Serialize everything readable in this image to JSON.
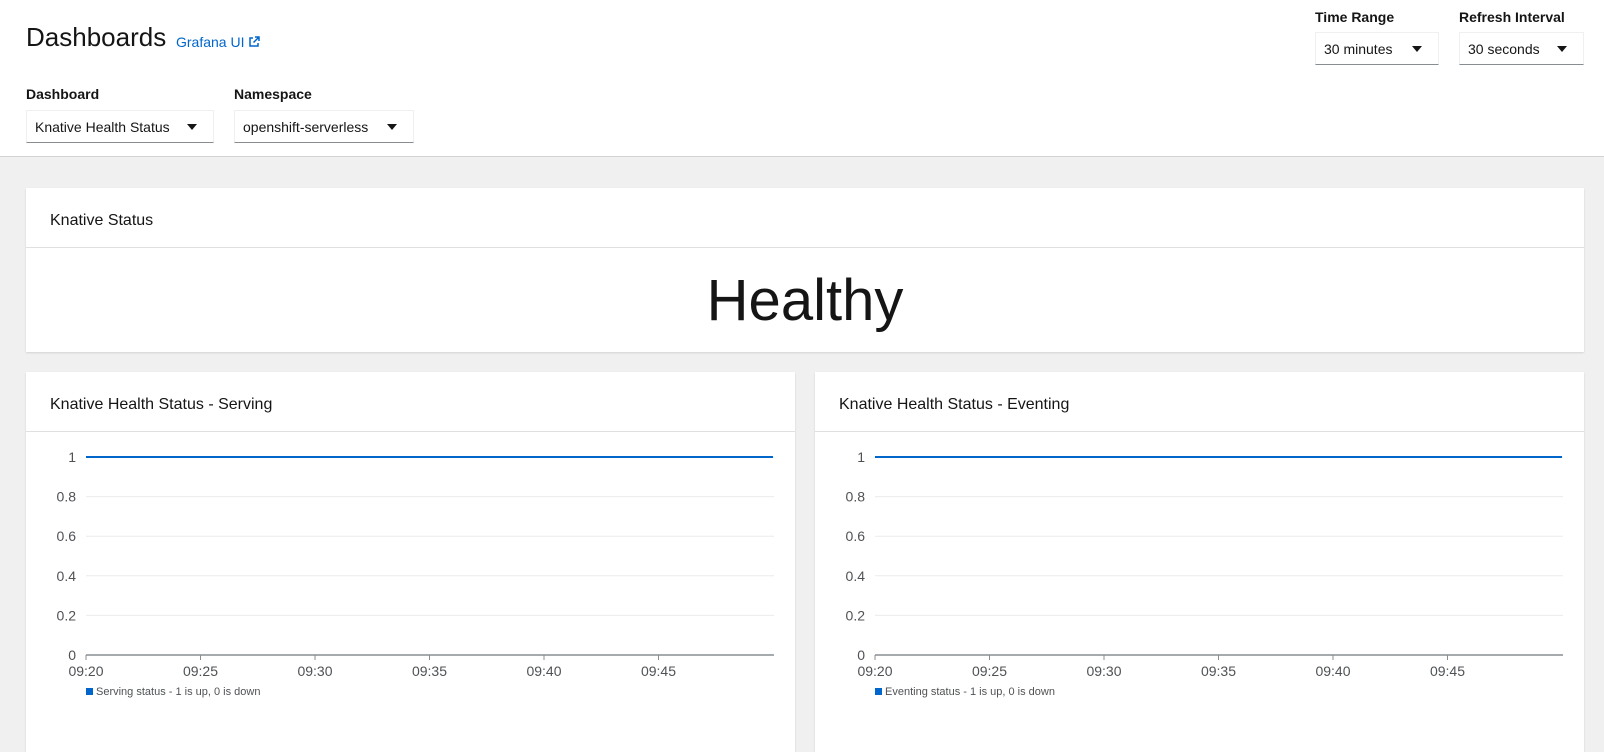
{
  "header": {
    "title": "Dashboards",
    "grafana_link": "Grafana UI",
    "dashboard_label": "Dashboard",
    "dashboard_value": "Knative Health Status",
    "namespace_label": "Namespace",
    "namespace_value": "openshift-serverless",
    "time_range_label": "Time Range",
    "time_range_value": "30 minutes",
    "refresh_label": "Refresh Interval",
    "refresh_value": "30 seconds"
  },
  "status_card": {
    "title": "Knative Status",
    "value": "Healthy"
  },
  "serving_card": {
    "title": "Knative Health Status - Serving"
  },
  "eventing_card": {
    "title": "Knative Health Status - Eventing"
  },
  "colors": {
    "accent": "#0066cc",
    "series": "#0066cc"
  },
  "chart_data": [
    {
      "type": "line",
      "title": "Knative Health Status - Serving",
      "x": [
        "09:20",
        "09:25",
        "09:30",
        "09:35",
        "09:40",
        "09:45",
        "09:50"
      ],
      "x_ticks": [
        "09:20",
        "09:25",
        "09:30",
        "09:35",
        "09:40",
        "09:45"
      ],
      "y_ticks": [
        "0",
        "0.2",
        "0.4",
        "0.6",
        "0.8",
        "1"
      ],
      "ylim": [
        0,
        1
      ],
      "series": [
        {
          "name": "Serving status - 1 is up, 0 is down",
          "values": [
            1,
            1,
            1,
            1,
            1,
            1,
            1
          ]
        }
      ],
      "legend": "bottom-left"
    },
    {
      "type": "line",
      "title": "Knative Health Status - Eventing",
      "x": [
        "09:20",
        "09:25",
        "09:30",
        "09:35",
        "09:40",
        "09:45",
        "09:50"
      ],
      "x_ticks": [
        "09:20",
        "09:25",
        "09:30",
        "09:35",
        "09:40",
        "09:45"
      ],
      "y_ticks": [
        "0",
        "0.2",
        "0.4",
        "0.6",
        "0.8",
        "1"
      ],
      "ylim": [
        0,
        1
      ],
      "series": [
        {
          "name": "Eventing status - 1 is up, 0 is down",
          "values": [
            1,
            1,
            1,
            1,
            1,
            1,
            1
          ]
        }
      ],
      "legend": "bottom-left"
    }
  ]
}
